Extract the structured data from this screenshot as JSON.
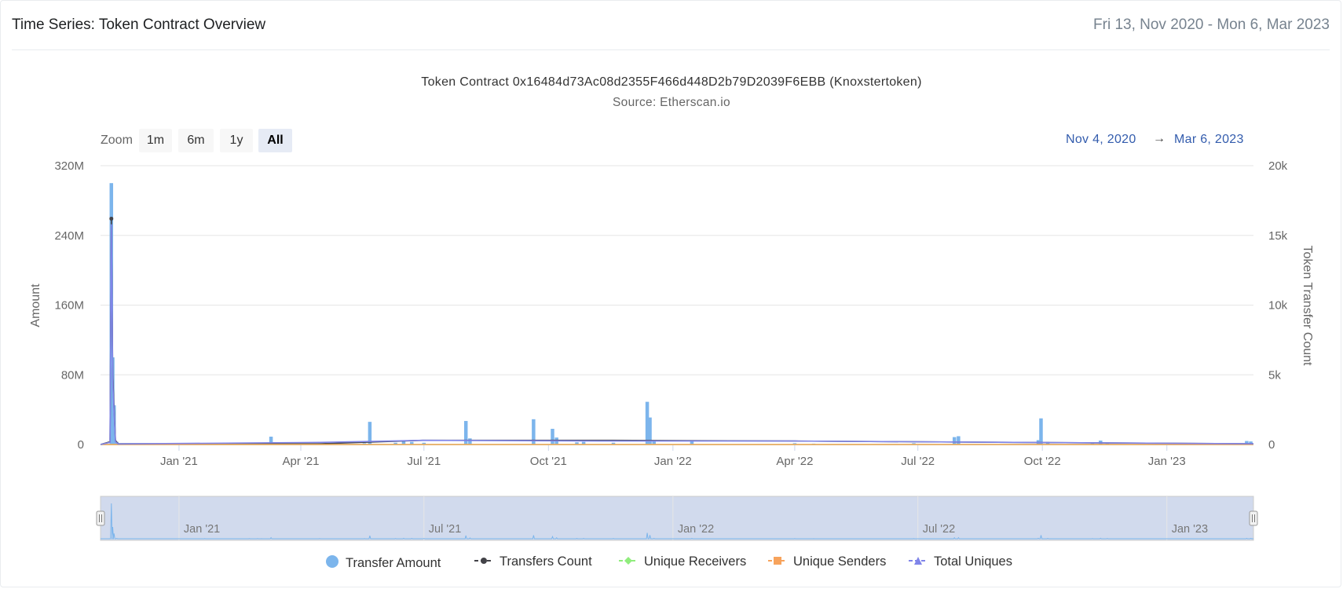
{
  "header": {
    "title": "Time Series: Token Contract Overview",
    "date_range": "Fri 13, Nov 2020 - Mon 6, Mar 2023"
  },
  "chart_data": {
    "type": "bar",
    "title": "Token Contract 0x16484d73Ac08d2355F466d448D2b79D2039F6EBB (Knoxstertoken)",
    "subtitle": "Source: Etherscan.io",
    "zoom": {
      "label": "Zoom",
      "buttons": [
        "1m",
        "6m",
        "1y",
        "All"
      ],
      "active": "All"
    },
    "range_selector": {
      "from": "Nov 4, 2020",
      "arrow": "→",
      "to": "Mar 6, 2023"
    },
    "x_range": [
      "2020-11-04",
      "2023-03-06"
    ],
    "x_ticks": [
      {
        "date": "2021-01-01",
        "label": "Jan '21"
      },
      {
        "date": "2021-04-01",
        "label": "Apr '21"
      },
      {
        "date": "2021-07-01",
        "label": "Jul '21"
      },
      {
        "date": "2021-10-01",
        "label": "Oct '21"
      },
      {
        "date": "2022-01-01",
        "label": "Jan '22"
      },
      {
        "date": "2022-04-01",
        "label": "Apr '22"
      },
      {
        "date": "2022-07-01",
        "label": "Jul '22"
      },
      {
        "date": "2022-10-01",
        "label": "Oct '22"
      },
      {
        "date": "2023-01-01",
        "label": "Jan '23"
      }
    ],
    "y_left": {
      "title": "Amount",
      "min": 0,
      "max": 320000000,
      "ticks": [
        0,
        80000000,
        160000000,
        240000000,
        320000000
      ],
      "tick_labels": [
        "0",
        "80M",
        "160M",
        "240M",
        "320M"
      ]
    },
    "y_right": {
      "title": "Token Transfer Count",
      "min": 0,
      "max": 20000,
      "ticks": [
        0,
        5000,
        10000,
        15000,
        20000
      ],
      "tick_labels": [
        "0",
        "5k",
        "10k",
        "15k",
        "20k"
      ]
    },
    "navigator": {
      "labels": [
        {
          "date": "2021-01-01",
          "label": "Jan '21"
        },
        {
          "date": "2021-07-01",
          "label": "Jul '21"
        },
        {
          "date": "2022-01-01",
          "label": "Jan '22"
        },
        {
          "date": "2022-07-01",
          "label": "Jul '22"
        },
        {
          "date": "2023-01-01",
          "label": "Jan '23"
        }
      ]
    },
    "series": [
      {
        "name": "Transfer Amount",
        "type": "column",
        "axis": "left",
        "color": "#7cb5ec",
        "points": [
          [
            "2020-11-12",
            300000000
          ],
          [
            "2020-11-13",
            100000000
          ],
          [
            "2020-11-14",
            45000000
          ],
          [
            "2020-11-16",
            3000000
          ],
          [
            "2021-01-20",
            1500000
          ],
          [
            "2021-02-22",
            1500000
          ],
          [
            "2021-02-28",
            1500000
          ],
          [
            "2021-03-03",
            1000000
          ],
          [
            "2021-03-10",
            9000000
          ],
          [
            "2021-04-15",
            1500000
          ],
          [
            "2021-05-18",
            1500000
          ],
          [
            "2021-05-22",
            26000000
          ],
          [
            "2021-06-10",
            2000000
          ],
          [
            "2021-06-16",
            4500000
          ],
          [
            "2021-06-22",
            3000000
          ],
          [
            "2021-07-01",
            2000000
          ],
          [
            "2021-08-01",
            27000000
          ],
          [
            "2021-08-04",
            7000000
          ],
          [
            "2021-09-20",
            29000000
          ],
          [
            "2021-10-04",
            18000000
          ],
          [
            "2021-10-07",
            8000000
          ],
          [
            "2021-10-22",
            2500000
          ],
          [
            "2021-10-27",
            3000000
          ],
          [
            "2021-11-18",
            2000000
          ],
          [
            "2021-12-13",
            49000000
          ],
          [
            "2021-12-15",
            31000000
          ],
          [
            "2021-12-18",
            4000000
          ],
          [
            "2022-01-15",
            4000000
          ],
          [
            "2022-04-01",
            1500000
          ],
          [
            "2022-04-15",
            1000000
          ],
          [
            "2022-06-28",
            1500000
          ],
          [
            "2022-07-28",
            8500000
          ],
          [
            "2022-07-31",
            9500000
          ],
          [
            "2022-09-28",
            5000000
          ],
          [
            "2022-09-30",
            30000000
          ],
          [
            "2022-10-05",
            3000000
          ],
          [
            "2022-11-07",
            1500000
          ],
          [
            "2022-11-13",
            4500000
          ],
          [
            "2022-11-18",
            2000000
          ],
          [
            "2023-03-01",
            4000000
          ],
          [
            "2023-03-04",
            3500000
          ]
        ]
      },
      {
        "name": "Transfers Count",
        "type": "line",
        "axis": "right",
        "color": "#434348",
        "points": [
          [
            "2020-11-04",
            0
          ],
          [
            "2020-11-11",
            200
          ],
          [
            "2020-11-12",
            16200
          ],
          [
            "2020-11-13",
            5000
          ],
          [
            "2020-11-15",
            300
          ],
          [
            "2020-11-17",
            50
          ],
          [
            "2021-04-15",
            50
          ],
          [
            "2021-06-30",
            300
          ],
          [
            "2021-11-17",
            300
          ],
          [
            "2022-04-01",
            250
          ],
          [
            "2023-03-06",
            50
          ]
        ]
      },
      {
        "name": "Unique Receivers",
        "type": "line",
        "axis": "right",
        "color": "#90ed7d",
        "points": [
          [
            "2020-11-04",
            0
          ],
          [
            "2023-03-06",
            0
          ]
        ]
      },
      {
        "name": "Unique Senders",
        "type": "line",
        "axis": "right",
        "color": "#f7a35c",
        "points": [
          [
            "2020-11-04",
            0
          ],
          [
            "2023-03-06",
            0
          ]
        ]
      },
      {
        "name": "Total Uniques",
        "type": "line",
        "axis": "right",
        "color": "#8085e9",
        "points": [
          [
            "2020-11-04",
            0
          ],
          [
            "2020-11-11",
            150
          ],
          [
            "2020-11-12",
            15800
          ],
          [
            "2020-11-13",
            4500
          ],
          [
            "2020-11-15",
            200
          ],
          [
            "2020-11-17",
            40
          ],
          [
            "2021-04-15",
            150
          ],
          [
            "2021-06-30",
            300
          ],
          [
            "2021-11-17",
            250
          ],
          [
            "2022-04-01",
            250
          ],
          [
            "2023-03-06",
            50
          ]
        ]
      }
    ],
    "legend": {
      "position": "bottom",
      "items": [
        "Transfer Amount",
        "Transfers Count",
        "Unique Receivers",
        "Unique Senders",
        "Total Uniques"
      ]
    }
  }
}
